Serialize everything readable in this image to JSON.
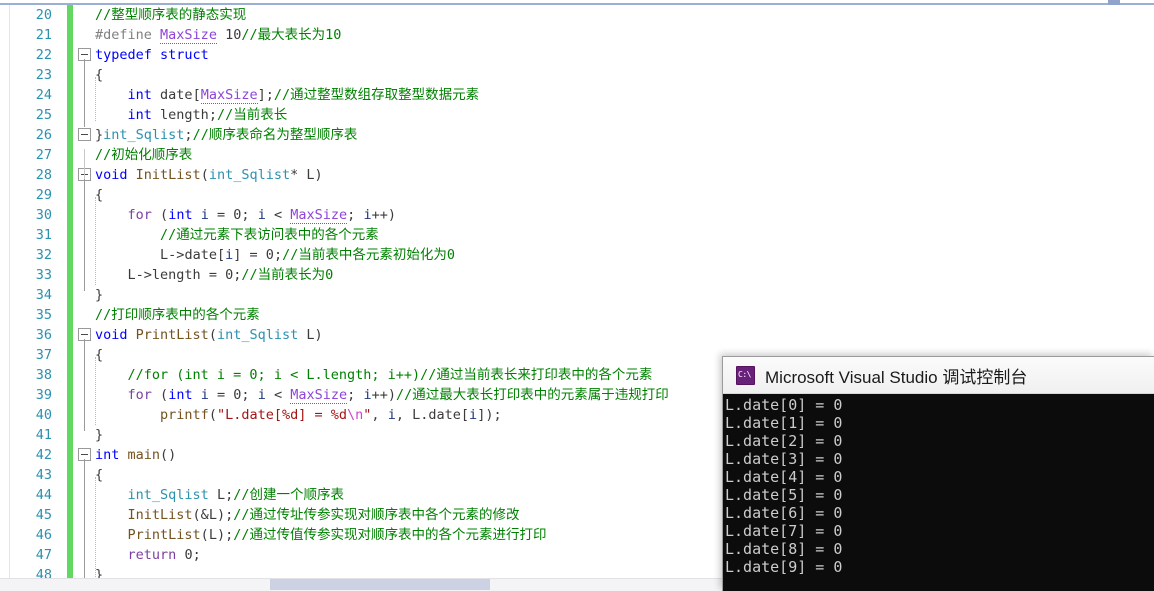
{
  "window": {
    "app": "Visual Studio Code Editor",
    "top_scroll_marker": "annotation-marker"
  },
  "editor": {
    "first_line_number": 20,
    "last_line_number": 48,
    "lines": [
      {
        "n": 20,
        "indent": 0,
        "fold": null,
        "text": "//整型顺序表的静态实现"
      },
      {
        "n": 21,
        "indent": 0,
        "fold": null,
        "text": "#define MaxSize 10//最大表长为10"
      },
      {
        "n": 22,
        "indent": 0,
        "fold": "minus",
        "text": "typedef struct"
      },
      {
        "n": 23,
        "indent": 0,
        "fold": null,
        "text": "{"
      },
      {
        "n": 24,
        "indent": 0,
        "fold": null,
        "text": "    int date[MaxSize];//通过整型数组存取整型数据元素"
      },
      {
        "n": 25,
        "indent": 0,
        "fold": null,
        "text": "    int length;//当前表长"
      },
      {
        "n": 26,
        "indent": 0,
        "fold": "minus",
        "text": "}int_Sqlist;//顺序表命名为整型顺序表"
      },
      {
        "n": 27,
        "indent": 0,
        "fold": null,
        "text": "//初始化顺序表"
      },
      {
        "n": 28,
        "indent": 0,
        "fold": "minus",
        "text": "void InitList(int_Sqlist* L)"
      },
      {
        "n": 29,
        "indent": 0,
        "fold": null,
        "text": "{"
      },
      {
        "n": 30,
        "indent": 0,
        "fold": null,
        "text": "    for (int i = 0; i < MaxSize; i++)"
      },
      {
        "n": 31,
        "indent": 0,
        "fold": null,
        "text": "        //通过元素下表访问表中的各个元素"
      },
      {
        "n": 32,
        "indent": 0,
        "fold": null,
        "text": "        L->date[i] = 0;//当前表中各元素初始化为0"
      },
      {
        "n": 33,
        "indent": 0,
        "fold": null,
        "text": "    L->length = 0;//当前表长为0"
      },
      {
        "n": 34,
        "indent": 0,
        "fold": null,
        "text": "}"
      },
      {
        "n": 35,
        "indent": 0,
        "fold": null,
        "text": "//打印顺序表中的各个元素"
      },
      {
        "n": 36,
        "indent": 0,
        "fold": "minus",
        "text": "void PrintList(int_Sqlist L)"
      },
      {
        "n": 37,
        "indent": 0,
        "fold": null,
        "text": "{"
      },
      {
        "n": 38,
        "indent": 0,
        "fold": null,
        "text": "    //for (int i = 0; i < L.length; i++)//通过当前表长来打印表中的各个元素"
      },
      {
        "n": 39,
        "indent": 0,
        "fold": null,
        "text": "    for (int i = 0; i < MaxSize; i++)//通过最大表长打印表中的元素属于违规打印"
      },
      {
        "n": 40,
        "indent": 0,
        "fold": null,
        "text": "        printf(\"L.date[%d] = %d\\n\", i, L.date[i]);"
      },
      {
        "n": 41,
        "indent": 0,
        "fold": null,
        "text": "}"
      },
      {
        "n": 42,
        "indent": 0,
        "fold": "minus",
        "text": "int main()"
      },
      {
        "n": 43,
        "indent": 0,
        "fold": null,
        "text": "{"
      },
      {
        "n": 44,
        "indent": 0,
        "fold": null,
        "text": "    int_Sqlist L;//创建一个顺序表"
      },
      {
        "n": 45,
        "indent": 0,
        "fold": null,
        "text": "    InitList(&L);//通过传址传参实现对顺序表中各个元素的修改"
      },
      {
        "n": 46,
        "indent": 0,
        "fold": null,
        "text": "    PrintList(L);//通过传值传参实现对顺序表中的各个元素进行打印"
      },
      {
        "n": 47,
        "indent": 0,
        "fold": null,
        "text": "    return 0;"
      },
      {
        "n": 48,
        "indent": 0,
        "fold": null,
        "text": "}"
      }
    ],
    "colors": {
      "linenumber": "#2b91af",
      "comment": "#008000",
      "keyword": "#0000ff",
      "keyword_control": "#7b3fa0",
      "preprocessor": "#808080",
      "macro": "#8e44d8",
      "usertype": "#2b91af",
      "function": "#74531f",
      "string": "#a31515",
      "escape": "#cc44cc",
      "changebar": "#62d862",
      "background": "#ffffff"
    }
  },
  "console": {
    "title": "Microsoft Visual Studio 调试控制台",
    "icon": "command-prompt-icon",
    "background": "#0c0c0c",
    "foreground": "#cccccc",
    "output": [
      "L.date[0] = 0",
      "L.date[1] = 0",
      "L.date[2] = 0",
      "L.date[3] = 0",
      "L.date[4] = 0",
      "L.date[5] = 0",
      "L.date[6] = 0",
      "L.date[7] = 0",
      "L.date[8] = 0",
      "L.date[9] = 0"
    ]
  },
  "scrollbars": {
    "horizontal_thumb_label": "horizontal-scroll-thumb",
    "top_marker_label": "top-scroll-marker"
  }
}
